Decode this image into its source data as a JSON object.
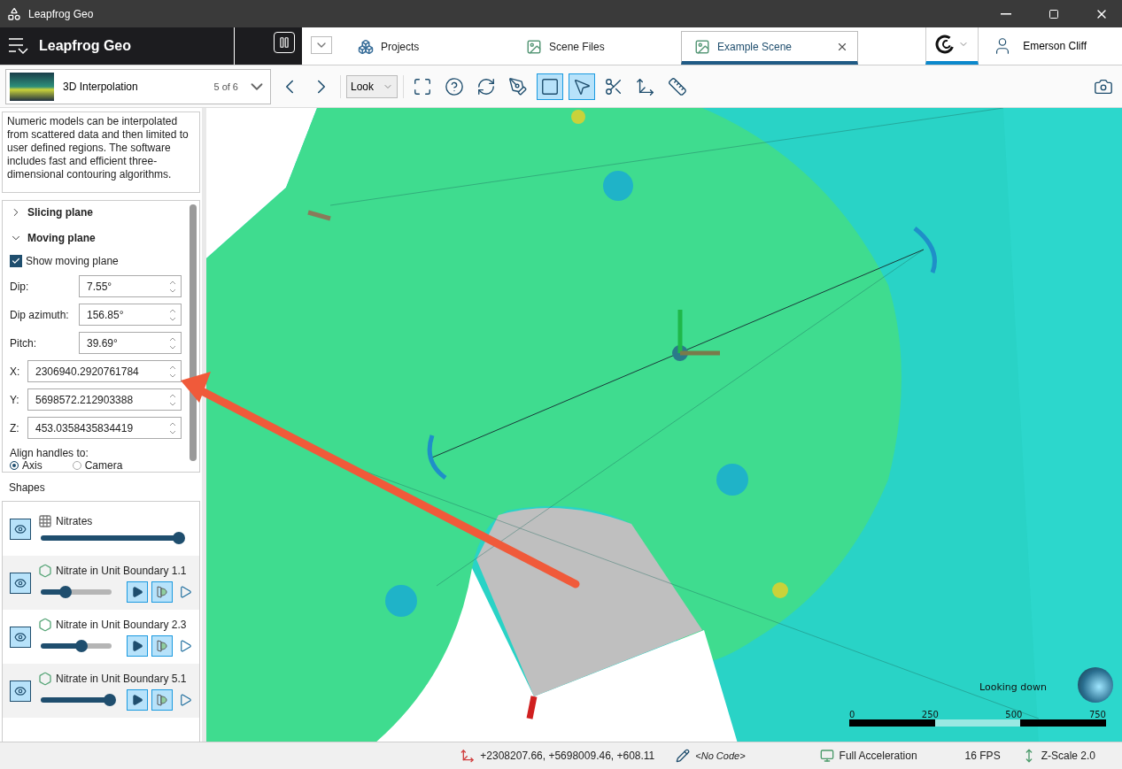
{
  "window": {
    "title": "Leapfrog Geo"
  },
  "app_bar": {
    "brand": "Leapfrog Geo"
  },
  "tabs": [
    {
      "label": "Projects",
      "kind": "projects",
      "selected": false
    },
    {
      "label": "Scene Files",
      "kind": "files",
      "selected": false
    },
    {
      "label": "Example Scene",
      "kind": "files",
      "selected": true
    }
  ],
  "user": {
    "name": "Emerson Cliff"
  },
  "scene_selector": {
    "title": "3D Interpolation",
    "position": "5 of 6"
  },
  "view_mode": {
    "value": "Look"
  },
  "tools": [
    {
      "kind": "fit",
      "selected": false
    },
    {
      "kind": "help",
      "selected": false
    },
    {
      "kind": "rotate",
      "selected": false
    },
    {
      "kind": "draw",
      "selected": false
    },
    {
      "kind": "plane",
      "selected": true
    },
    {
      "kind": "select",
      "selected": true
    },
    {
      "kind": "slice",
      "selected": false
    },
    {
      "kind": "move-plane",
      "selected": false
    },
    {
      "kind": "measure",
      "selected": false
    }
  ],
  "description": "Numeric models can be interpolated from scattered data and then limited to user defined regions. The software includes fast and efficient three-dimensional contouring algorithms.",
  "properties": {
    "sections": [
      {
        "label": "Slicing plane",
        "expanded": false
      },
      {
        "label": "Moving plane",
        "expanded": true
      }
    ],
    "show_moving_plane": {
      "label": "Show moving plane",
      "checked": true
    },
    "fields": [
      {
        "label": "Dip:",
        "kind": "angle",
        "value": "7.55°"
      },
      {
        "label": "Dip azimuth:",
        "kind": "angle",
        "value": "156.85°"
      },
      {
        "label": "Pitch:",
        "kind": "angle",
        "value": "39.69°"
      },
      {
        "label": "X:",
        "kind": "coordinate",
        "value": "2306940.2920761784"
      },
      {
        "label": "Y:",
        "kind": "coordinate",
        "value": "5698572.212903388"
      },
      {
        "label": "Z:",
        "kind": "coordinate",
        "value": "453.0358435834419"
      }
    ],
    "align": {
      "label": "Align handles to:",
      "options": [
        {
          "label": "Axis",
          "selected": true
        },
        {
          "label": "Camera",
          "selected": false
        }
      ]
    }
  },
  "shapes": {
    "title": "Shapes",
    "items": [
      {
        "name": "Nitrates",
        "kind": "points",
        "level": 1.0
      },
      {
        "name": "Nitrate in Unit Boundary 1.1",
        "kind": "surface",
        "level": 0.32
      },
      {
        "name": "Nitrate in Unit Boundary 2.3",
        "kind": "surface",
        "level": 0.55
      },
      {
        "name": "Nitrate in Unit Boundary 5.1",
        "kind": "surface",
        "level": 0.97
      }
    ]
  },
  "viewport": {
    "orientation": "Looking down",
    "scale": [
      "0",
      "250",
      "500",
      "750"
    ]
  },
  "status_bar": {
    "coordinates": "+2308207.66, +5698009.46, +608.11",
    "code": "<No Code>",
    "acceleration": "Full Acceleration",
    "fps": "16 FPS",
    "z_scale": "Z-Scale 2.0"
  }
}
